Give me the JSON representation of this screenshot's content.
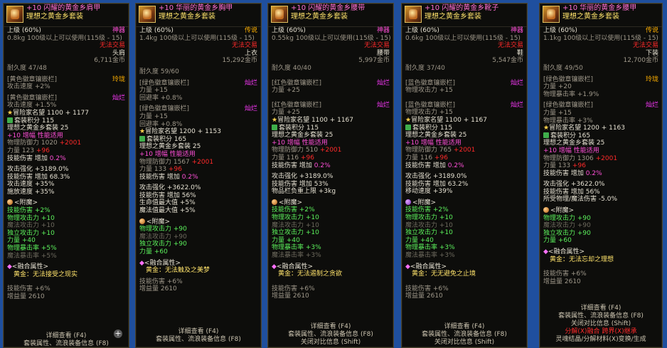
{
  "panels": [
    {
      "name": "+10 闪耀的黄金乡肩甲",
      "set_name": "理想之黄金乡套装",
      "grade_left": "上级 (60%)",
      "grade_right": "神器",
      "weight": "0.8kg",
      "level_req": "100级以上可以使用(115级 - 15)",
      "trade": "无法交易",
      "slot": "头肩",
      "price": "6,711金币",
      "durability": "耐久度 47/48",
      "s1_label": "[黄色徽章镶嵌栏]",
      "s1_grade": "玲珑",
      "s1_attr": "攻击速度 +2%",
      "s2_label": "[黄色徽章镶嵌栏]",
      "s2_grade": "灿烂",
      "s2_attr": "攻击速度 +1.5%",
      "adv": "冒险家名望 1100 + 1177",
      "setpts": "套装积分 115",
      "settext": "理想之黄金乡套装 25",
      "amp": "+10 增幅 性能适用",
      "def_label": "物理防御力 1020",
      "def_bonus": "+2001",
      "str_label": "力量 123",
      "str_bonus": "+96",
      "skdmg_label": "技能伤害 增加",
      "skdmg_val": "0.2%",
      "buf1": "攻击强化 +3189.0%",
      "buf2": "技能伤害 增加 68.3%",
      "buf3": "攻击速度 +35%",
      "buf4": "施放速度 +35%",
      "ench_title": "<附魔>",
      "ench1": "技能伤害 +2%",
      "ench2": "物理攻击力 +10",
      "ench3": "魔法攻击力 +10",
      "ench4": "独立攻击力 +10",
      "ench5": "力量 +40",
      "ench6": "物理暴击率 +5%",
      "ench7": "魔法暴击率 +5%",
      "fuse_title": "<融合属性>",
      "fuse_text": "黄金：无法接受之现实",
      "skill_pct": "技能伤害 +6%",
      "gain": "增益量 2610",
      "f1": "详细查看 (F4)",
      "f2": "套装属性、流浪装备信息 (F8)"
    },
    {
      "name": "+10 华丽的黄金乡胸甲",
      "set_name": "理想之黄金乡套装",
      "grade_left": "上级 (60%)",
      "grade_right": "传说",
      "weight": "1.4kg",
      "level_req": "100级以上可以使用(115级 - 15)",
      "trade": "无法交易",
      "slot": "上衣",
      "price": "15,292金币",
      "durability": "耐久度 59/60",
      "s1_label": "[绿色徽章镶嵌栏]",
      "s1_grade": "灿烂",
      "s1_attr": "力量 +15",
      "s1_attr2": "回避率 +0.8%",
      "s2_label": "[绿色徽章镶嵌栏]",
      "s2_grade": "灿烂",
      "s2_attr": "力量 +15",
      "s2_attr2": "回避率 +0.8%",
      "adv": "冒险家名望 1200 + 1153",
      "setpts": "套装积分 165",
      "settext": "理想之黄金乡套装 25",
      "amp": "+10 增幅 性能适用",
      "def_label": "物理防御力 1567",
      "def_bonus": "+2001",
      "str_label": "力量 133",
      "str_bonus": "+96",
      "skdmg_label": "技能伤害 增加",
      "skdmg_val": "0.2%",
      "buf1": "攻击强化 +3622.0%",
      "buf2": "技能伤害 增加 56%",
      "buf3": "生命值最大值 +5%",
      "buf4": "魔法值最大值 +5%",
      "ench_title": "<附魔>",
      "ench1": "物理攻击力 +90",
      "ench2": "魔法攻击力 +90",
      "ench3": "独立攻击力 +90",
      "ench4": "力量 +60",
      "fuse_title": "<融合属性>",
      "fuse_text": "黄金：无法触及之美梦",
      "skill_pct": "技能伤害 +6%",
      "gain": "增益量 2610",
      "f1": "详细查看 (F4)",
      "f2": "套装属性、流浪装备信息 (F8)"
    },
    {
      "name": "+10 闪耀的黄金乡腰带",
      "set_name": "理想之黄金乡套装",
      "grade_left": "上级 (60%)",
      "grade_right": "神器",
      "weight": "0.55kg",
      "level_req": "100级以上可以使用(115级 - 15)",
      "trade": "无法交易",
      "slot": "腰带",
      "price": "5,997金币",
      "durability": "耐久度 40/40",
      "s1_label": "[红色徽章镶嵌栏]",
      "s1_grade": "灿烂",
      "s1_attr": "力量 +25",
      "s2_label": "[红色徽章镶嵌栏]",
      "s2_grade": "灿烂",
      "s2_attr": "力量 +25",
      "adv": "冒险家名望 1100 + 1167",
      "setpts": "套装积分 115",
      "settext": "理想之黄金乡套装 25",
      "amp": "+10 增幅 性能适用",
      "def_label": "物理防御力 510",
      "def_bonus": "+2001",
      "str_label": "力量 116",
      "str_bonus": "+96",
      "skdmg_label": "技能伤害 增加",
      "skdmg_val": "0.2%",
      "buf1": "攻击强化 +3189.0%",
      "buf2": "技能伤害 增加 53%",
      "buf3": "物品栏负重上限 +3kg",
      "ench_title": "<附魔>",
      "ench1": "技能伤害 +2%",
      "ench2": "物理攻击力 +10",
      "ench3": "魔法攻击力 +10",
      "ench4": "独立攻击力 +10",
      "ench5": "力量 +40",
      "ench6": "物理暴击率 +3%",
      "ench7": "魔法暴击率 +3%",
      "fuse_title": "<融合属性>",
      "fuse_text": "黄金：无法遏制之贪欲",
      "skill_pct": "技能伤害 +6%",
      "gain": "增益量 2610",
      "f1": "详细查看 (F4)",
      "f2": "套装属性、流浪装备信息 (F8)",
      "f3": "关闭对比信息 (Shift)"
    },
    {
      "name": "+10 闪耀的黄金乡靴子",
      "set_name": "理想之黄金乡套装",
      "grade_left": "上级 (60%)",
      "grade_right": "神器",
      "weight": "0.6kg",
      "level_req": "100级以上可以使用(115级 - 15)",
      "trade": "无法交易",
      "slot": "鞋",
      "price": "5,547金币",
      "durability": "耐久度 37/40",
      "s1_label": "[蓝色徽章镶嵌栏]",
      "s1_grade": "灿烂",
      "s1_attr": "物理攻击力 +15",
      "s2_label": "[蓝色徽章镶嵌栏]",
      "s2_grade": "灿烂",
      "s2_attr": "物理攻击力 +15",
      "adv": "冒险家名望 1100 + 1167",
      "setpts": "套装积分 115",
      "settext": "理想之黄金乡套装 25",
      "amp": "+10 增幅 性能适用",
      "def_label": "物理防御力 765",
      "def_bonus": "+2001",
      "str_label": "力量 116",
      "str_bonus": "+96",
      "skdmg_label": "技能伤害 增加",
      "skdmg_val": "0.2%",
      "buf1": "攻击强化 +3189.0%",
      "buf2": "技能伤害 增加 63.2%",
      "buf3": "移动速度 +39%",
      "ench_title": "<附魔>",
      "ench1": "技能伤害 +2%",
      "ench2": "物理攻击力 +10",
      "ench3": "魔法攻击力 +10",
      "ench4": "独立攻击力 +10",
      "ench5": "力量 +40",
      "ench6": "物理暴击率 +3%",
      "ench7": "魔法暴击率 +3%",
      "fuse_title": "<融合属性>",
      "fuse_text": "黄金：无无避免之止境",
      "skill_pct": "技能伤害 +6%",
      "gain": "增益量 2610",
      "f1": "详细查看 (F4)",
      "f2": "套装属性、流浪装备信息 (F8)",
      "f3": "关闭对比信息 (Shift)"
    },
    {
      "name": "+10 华丽的黄金乡腰甲",
      "set_name": "理想之黄金乡套装",
      "grade_left": "上级 (60%)",
      "grade_right": "传说",
      "weight": "1.1kg",
      "level_req": "100级以上可以使用(115级 - 15)",
      "trade": "无法交易",
      "slot": "下装",
      "price": "12,700金币",
      "durability": "耐久度 49/50",
      "s1_label": "[绿色徽章镶嵌栏]",
      "s1_grade": "玲珑",
      "s1_attr": "力量 +20",
      "s1_attr2": "物理暴击率 +1.9%",
      "s2_label": "[绿色徽章镶嵌栏]",
      "s2_grade": "灿烂",
      "s2_attr": "力量 +15",
      "s2_attr2": "物理暴击率 +3%",
      "adv": "冒险家名望 1200 + 1163",
      "setpts": "套装积分 165",
      "settext": "理想之黄金乡套装 25",
      "amp": "+10 增幅 性能适用",
      "def_label": "物理防御力 1306",
      "def_bonus": "+2001",
      "str_label": "力量 133",
      "str_bonus": "+96",
      "skdmg_label": "技能伤害 增加",
      "skdmg_val": "0.2%",
      "buf1": "攻击强化 +3622.0%",
      "buf2": "技能伤害 增加 56%",
      "buf3": "所受物理/魔法伤害 -5.0%",
      "ench_title": "<附魔>",
      "ench1": "物理攻击力 +90",
      "ench2": "魔法攻击力 +90",
      "ench3": "独立攻击力 +90",
      "ench4": "力量 +60",
      "fuse_title": "<融合属性>",
      "fuse_text": "黄金：无法忘却之理想",
      "skill_pct": "技能伤害 +6%",
      "gain": "增益量 2610",
      "f1": "详细查看 (F4)",
      "f2": "套装属性、流浪装备信息 (F8)",
      "f3": "关闭对比信息 (Shift)",
      "f4a": "分解(X)融合",
      "f4b": "跨界(X)继承",
      "f5": "灵魂结晶/分解材料(X)变换/生成"
    }
  ]
}
